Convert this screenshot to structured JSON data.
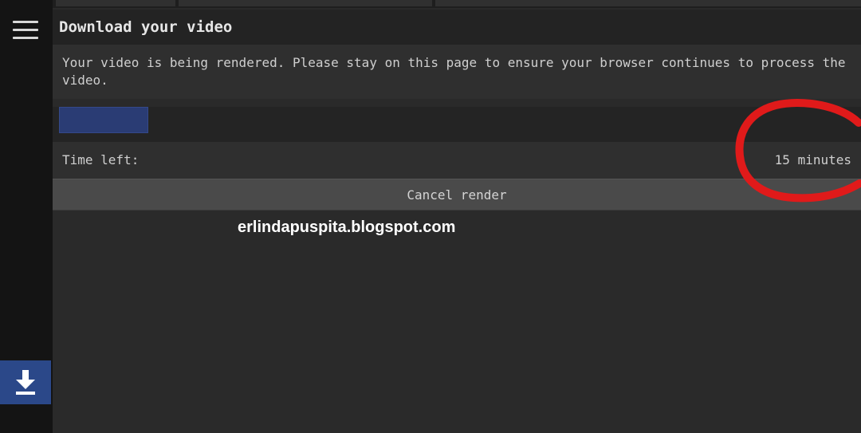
{
  "sidebar": {
    "menu_icon": "hamburger-menu-icon",
    "download_icon": "download-icon",
    "download_color": "#2b4889"
  },
  "dialog": {
    "title": "Download your video",
    "message": "Your video is being rendered. Please stay on this page to ensure your browser continues to process the video.",
    "progress_fraction": 0.11,
    "time_left_label": "Time left:",
    "time_left_value": "15 minutes",
    "cancel_label": "Cancel render"
  },
  "watermark": {
    "text": "erlindapuspita.blogspot.com"
  },
  "annotation": {
    "color": "#e01a1a"
  }
}
